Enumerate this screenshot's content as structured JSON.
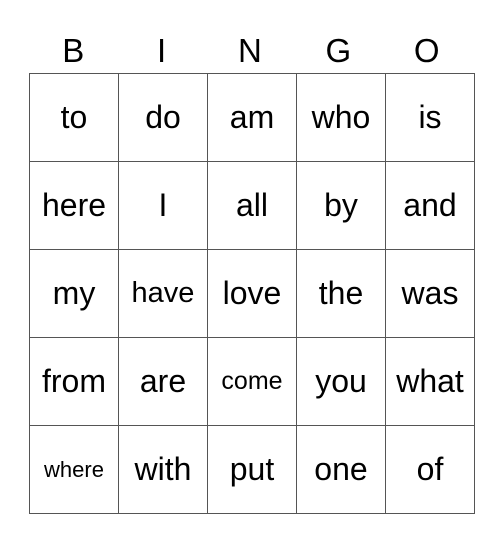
{
  "card": {
    "header": [
      "B",
      "I",
      "N",
      "G",
      "O"
    ],
    "rows": [
      [
        "to",
        "do",
        "am",
        "who",
        "is"
      ],
      [
        "here",
        "I",
        "all",
        "by",
        "and"
      ],
      [
        "my",
        "have",
        "love",
        "the",
        "was"
      ],
      [
        "from",
        "are",
        "come",
        "you",
        "what"
      ],
      [
        "where",
        "with",
        "put",
        "one",
        "of"
      ]
    ]
  }
}
